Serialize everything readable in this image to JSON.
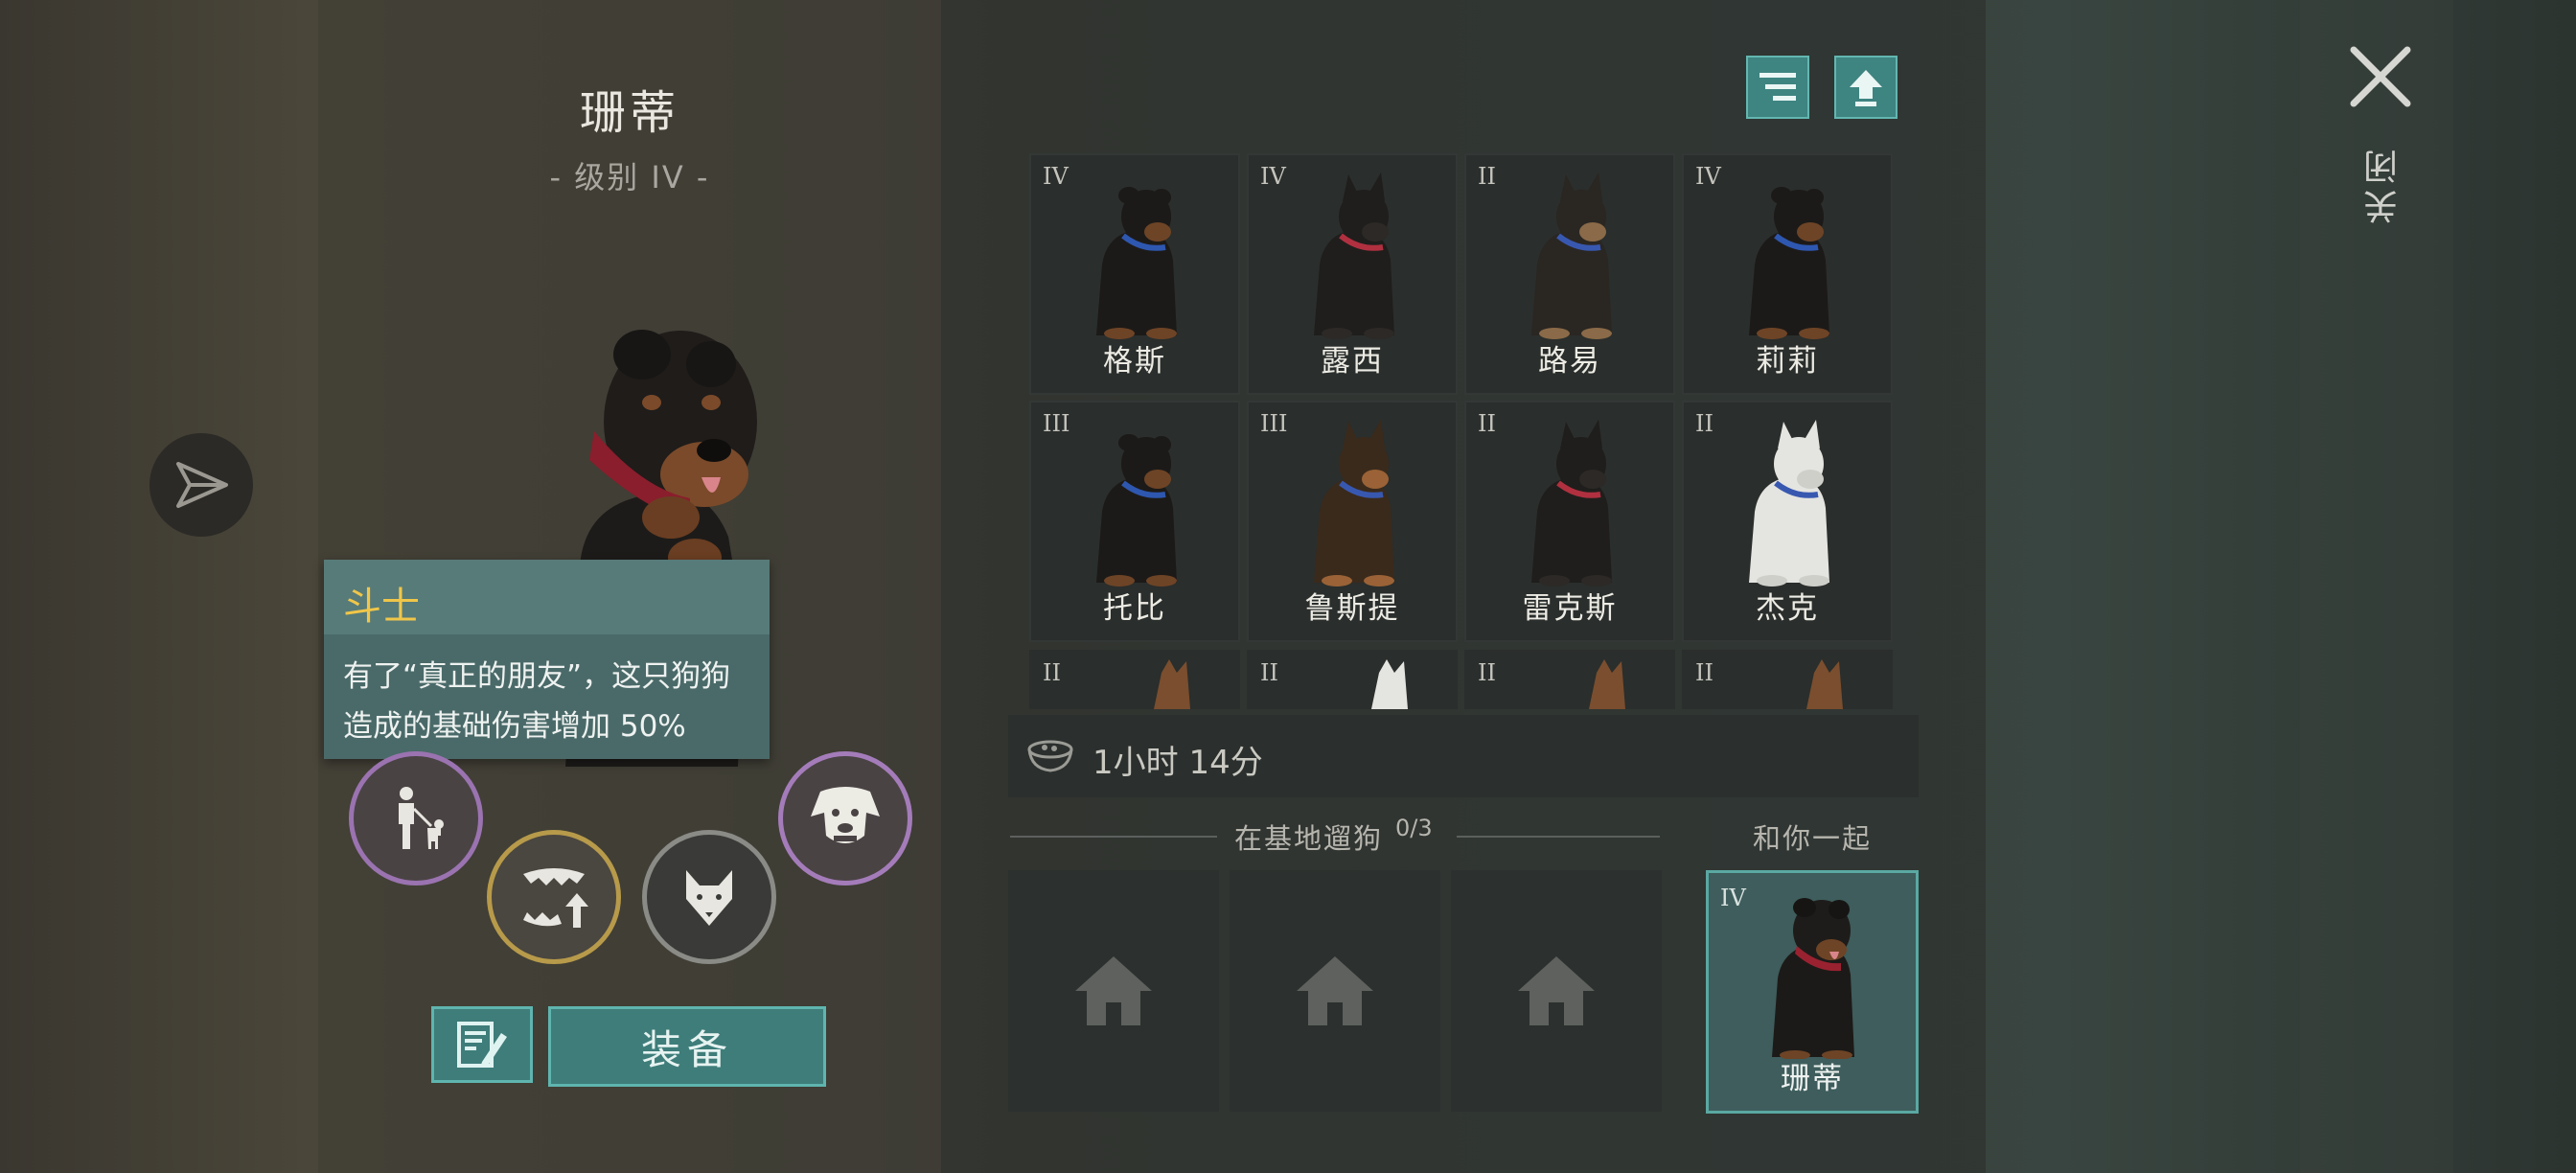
{
  "dog": {
    "name": "珊蒂",
    "level": "- 级别 IV -"
  },
  "tooltip": {
    "title": "斗士",
    "description": "有了“真正的朋友”，这只狗狗造成的基础伤害增加 50%"
  },
  "actions": {
    "equip_label": "装备"
  },
  "icons": {
    "send": "send-arrow-icon",
    "sort": "sort-icon",
    "upgrade": "upgrade-arrow-icon",
    "close": "close-icon",
    "timer": "food-bowl-icon",
    "home": "house-icon",
    "rename": "edit-note-icon",
    "skills": [
      "person-with-dog-icon",
      "fangs-upgrade-icon",
      "wolf-head-icon",
      "dog-face-icon"
    ]
  },
  "dogs": [
    {
      "tier": "IV",
      "name": "格斯",
      "breed": "rottweiler"
    },
    {
      "tier": "IV",
      "name": "露西",
      "breed": "black-shepherd"
    },
    {
      "tier": "II",
      "name": "路易",
      "breed": "shepherd"
    },
    {
      "tier": "IV",
      "name": "莉莉",
      "breed": "rottweiler"
    },
    {
      "tier": "III",
      "name": "托比",
      "breed": "rottweiler"
    },
    {
      "tier": "III",
      "name": "鲁斯提",
      "breed": "tan-shepherd"
    },
    {
      "tier": "II",
      "name": "雷克斯",
      "breed": "black-shepherd"
    },
    {
      "tier": "II",
      "name": "杰克",
      "breed": "white-shepherd"
    }
  ],
  "partial_row": [
    {
      "tier": "II"
    },
    {
      "tier": "II"
    },
    {
      "tier": "II"
    },
    {
      "tier": "II"
    }
  ],
  "timer": {
    "text": "1小时 14分"
  },
  "walk": {
    "label": "在基地遛狗",
    "count": "0/3"
  },
  "with_you": {
    "label": "和你一起",
    "tier": "IV",
    "name": "珊蒂"
  },
  "close": {
    "label": "关闭"
  },
  "colors": {
    "accent": "#3e7d7a",
    "tooltip_title": "#f0c649",
    "skill_purple": "#9a73b0",
    "skill_gold": "#b79a4a"
  }
}
